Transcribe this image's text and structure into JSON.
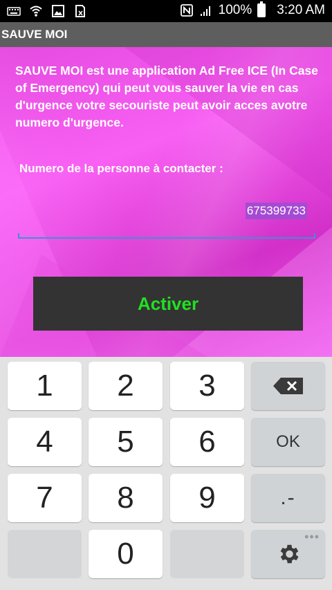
{
  "status_bar": {
    "battery": "100%",
    "time": "3:20 AM",
    "icons": [
      "keyboard-icon",
      "wifi-icon",
      "image-icon",
      "sim-icon",
      "nfc-icon",
      "signal-icon",
      "battery-icon"
    ]
  },
  "app": {
    "title": "SAUVE MOI"
  },
  "main": {
    "intro": "SAUVE MOI est une application Ad Free ICE (In Case of Emergency) qui peut vous sauver la vie en cas d'urgence votre secouriste peut avoir acces avotre numero d'urgence.",
    "phone_label": "Numero de la personne à  contacter  :",
    "phone_value": "675399733",
    "activate_label": "Activer"
  },
  "keypad": {
    "keys": [
      "1",
      "2",
      "3",
      "4",
      "5",
      "6",
      "7",
      "8",
      "9",
      "0"
    ],
    "ok_label": "OK",
    "dot_dash_label": ".-",
    "dots": "•••"
  },
  "colors": {
    "status_bar": "#000000",
    "title_bar": "#5e5e5e",
    "background_magenta": "#f060ee",
    "activate_bg": "#333333",
    "activate_text": "#22e022",
    "phone_highlight": "#a44bd2",
    "input_underline": "#3f8fd6",
    "keypad_bg": "#e2e2e2"
  }
}
